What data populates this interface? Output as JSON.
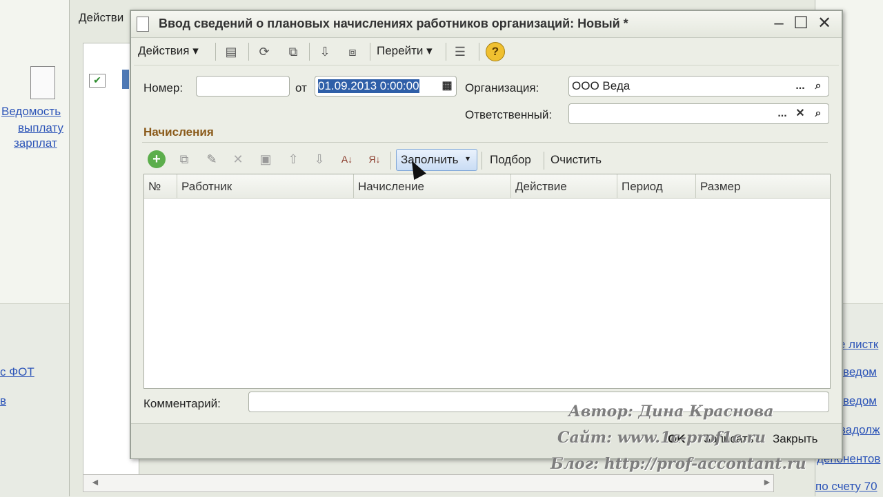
{
  "background": {
    "tab_label": "Действи",
    "links_left": [
      "Ведомость",
      "выплату",
      "зарплат"
    ],
    "link_fot": "с ФОТ",
    "link_v": "в",
    "links_right": [
      "е листк",
      "ведом",
      "ведом",
      "задолж",
      "депонентов",
      "по счету 70"
    ]
  },
  "dialog": {
    "title": "Ввод сведений о плановых начислениях работников организаций: Новый *",
    "toolbar": {
      "actions_label": "Действия",
      "goto_label": "Перейти",
      "help": "?"
    },
    "form": {
      "number_label": "Номер:",
      "number_value": "",
      "from_label": "от",
      "date_value": "01.09.2013  0:00:00",
      "org_label": "Организация:",
      "org_value": "ООО Веда",
      "resp_label": "Ответственный:",
      "resp_value": "",
      "dots": "...",
      "clear": "✕"
    },
    "section_title": "Начисления",
    "table_toolbar": {
      "fill_label": "Заполнить",
      "select_label": "Подбор",
      "clear_label": "Очистить"
    },
    "columns": [
      "№",
      "Работник",
      "Начисление",
      "Действие",
      "Период",
      "Размер"
    ],
    "comment_label": "Комментарий:",
    "comment_value": "",
    "footer": {
      "ok": "OK",
      "save": "Записать",
      "close": "Закрыть"
    }
  },
  "watermark": {
    "author": "Автор: Дина Краснова",
    "site": "Сайт: www.1c-prof1c.ru",
    "blog": "Блог: http://prof-accontant.ru"
  }
}
